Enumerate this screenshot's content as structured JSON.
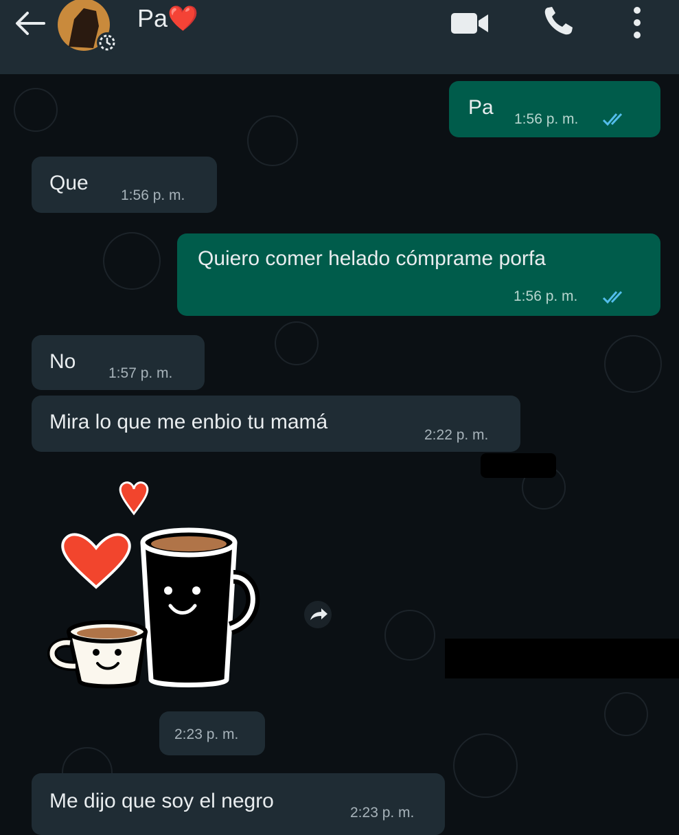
{
  "header": {
    "contact_name": "Pa",
    "name_emoji": "❤️",
    "icons": [
      "back-arrow-icon",
      "avatar",
      "video-call-icon",
      "phone-icon",
      "menu-dots-icon"
    ]
  },
  "messages": [
    {
      "dir": "out",
      "text": "Pa",
      "time": "1:56 p. m.",
      "status": "read"
    },
    {
      "dir": "in",
      "text": "Que",
      "time": "1:56 p. m."
    },
    {
      "dir": "out",
      "text": "Quiero comer helado cómprame porfa",
      "time": "1:56 p. m.",
      "status": "read"
    },
    {
      "dir": "in",
      "text": "No",
      "time": "1:57 p. m."
    },
    {
      "dir": "in",
      "text": "Mira lo que me enbio tu mamá",
      "time": "2:22 p. m."
    },
    {
      "dir": "in",
      "type": "sticker",
      "sticker": "coffee-cups-couple",
      "time": "2:23 p. m."
    },
    {
      "dir": "in",
      "text": "Me dijo que soy el negro",
      "time": "2:23 p. m."
    }
  ],
  "colors": {
    "header_bg": "#1f2c34",
    "chat_bg": "#0b1014",
    "incoming_bubble": "#1f2c34",
    "outgoing_bubble": "#005c4b",
    "read_ticks": "#53bdeb",
    "heart": "#f2452d"
  }
}
